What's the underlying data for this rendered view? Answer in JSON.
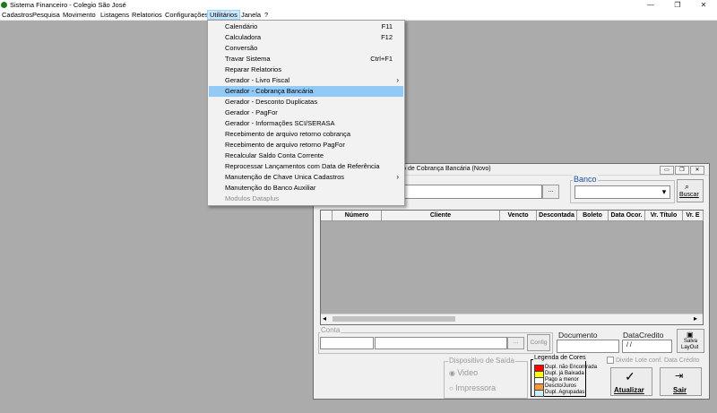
{
  "window": {
    "title": "Sistema Financeiro - Colegio São José",
    "minimize": "—",
    "maximize": "❐",
    "close": "✕"
  },
  "menubar": {
    "items": [
      "Cadastros",
      "Pesquisa",
      "Movimento",
      "Listagens",
      "Relatorios",
      "Configurações",
      "Utilitários",
      "Janela",
      "?"
    ],
    "active": "Utilitários"
  },
  "dropdown": {
    "items": [
      {
        "label": "Calendário",
        "shortcut": "F11"
      },
      {
        "label": "Calculadora",
        "shortcut": "F12"
      },
      {
        "label": "Conversão",
        "shortcut": ""
      },
      {
        "label": "Travar Sistema",
        "shortcut": "Ctrl+F1"
      },
      {
        "label": "Reparar Relatorios",
        "shortcut": ""
      },
      {
        "label": "Gerador - Livro Fiscal",
        "shortcut": "",
        "submenu": "›"
      },
      {
        "label": "Gerador - Cobrança Bancária",
        "shortcut": "",
        "highlighted": true
      },
      {
        "label": "Gerador - Desconto Duplicatas",
        "shortcut": ""
      },
      {
        "label": "Gerador - PagFor",
        "shortcut": ""
      },
      {
        "label": "Gerador - Informações SCI/SERASA",
        "shortcut": ""
      },
      {
        "label": "Recebimento de arquivo retorno cobrança",
        "shortcut": ""
      },
      {
        "label": "Recebimento de arquivo retorno PagFor",
        "shortcut": ""
      },
      {
        "label": "Recalcular Saldo Conta Corrente",
        "shortcut": ""
      },
      {
        "label": "Reprocessar Lançamentos com Data de Referência",
        "shortcut": ""
      },
      {
        "label": "Manutenção de Chave Unica Cadastros",
        "shortcut": "",
        "submenu": "›"
      },
      {
        "label": "Manutenção do Banco Auxiliar",
        "shortcut": ""
      },
      {
        "label": "Modulos Dataplus",
        "shortcut": "",
        "disabled": true
      }
    ]
  },
  "child": {
    "title": "orno de Cobrança Bancária (Novo)",
    "browse_btn": "...",
    "banco_label": "Banco",
    "banco_arrow": "▾",
    "buscar_label": "Buscar",
    "grid_headers": [
      "",
      "Número",
      "Cliente",
      "Vencto",
      "Descontada",
      "Boleto",
      "Data Ocor.",
      "Vr. Título",
      "Vr. E"
    ],
    "scroll_left": "◂",
    "scroll_right": "▸",
    "conta_label": "Conta",
    "conta_browse": "...",
    "config_btn": "Config",
    "documento_label": "Documento",
    "datacredito_label": "DataCredito",
    "datacredito_value": "/ /",
    "salva_label_1": "Salva",
    "salva_label_2": "LayOut",
    "dispositivo_label": "Dispositivo de Saída",
    "radio_video": "Video",
    "radio_impressora": "Impressora",
    "legenda_label": "Legenda de Cores",
    "legend": [
      {
        "label": "Dupl. não Encontrada",
        "color": "#ff0000"
      },
      {
        "label": "Dupl. já Baixada",
        "color": "#ffff00"
      },
      {
        "label": "Pago a menor",
        "color": "#ffffff"
      },
      {
        "label": "Descto/Juros",
        "color": "#ff9933"
      },
      {
        "label": "Dupl. Agrupadas",
        "color": "#c8f0f8"
      }
    ],
    "divide_label": "Divide Lote conf. Data Crédito",
    "atualizar_label": "Atualizar",
    "sair_label": "Sair"
  }
}
